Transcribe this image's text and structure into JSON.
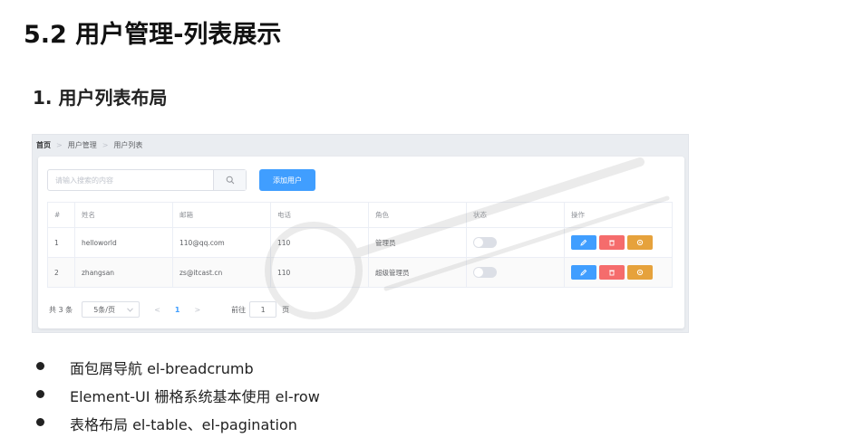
{
  "heading": "5.2 用户管理-列表展示",
  "subheading": "1. 用户列表布局",
  "breadcrumb": [
    "首页",
    "用户管理",
    "用户列表"
  ],
  "search": {
    "placeholder": "请输入搜索的内容",
    "icon": "search-icon"
  },
  "add_button": "添加用户",
  "table": {
    "columns": [
      "#",
      "姓名",
      "邮箱",
      "电话",
      "角色",
      "状态",
      "操作"
    ],
    "rows": [
      {
        "index": "1",
        "name": "helloworld",
        "email": "110@qq.com",
        "phone": "110",
        "role": "管理员",
        "status_on": false
      },
      {
        "index": "2",
        "name": "zhangsan",
        "email": "zs@itcast.cn",
        "phone": "110",
        "role": "超级管理员",
        "status_on": false
      }
    ],
    "action_icons": [
      "edit-icon",
      "delete-icon",
      "settings-icon"
    ]
  },
  "pagination": {
    "total": "共 3 条",
    "page_size": "5条/页",
    "prev": "<",
    "current": "1",
    "next": ">",
    "goto_label": "前往",
    "goto_value": "1",
    "page_suffix": "页"
  },
  "colors": {
    "primary": "#409eff",
    "danger": "#f56c6c",
    "warning": "#e6a23c"
  },
  "bullets": [
    "面包屑导航 el-breadcrumb",
    "Element-UI 栅格系统基本使用 el-row",
    "表格布局 el-table、el-pagination"
  ]
}
